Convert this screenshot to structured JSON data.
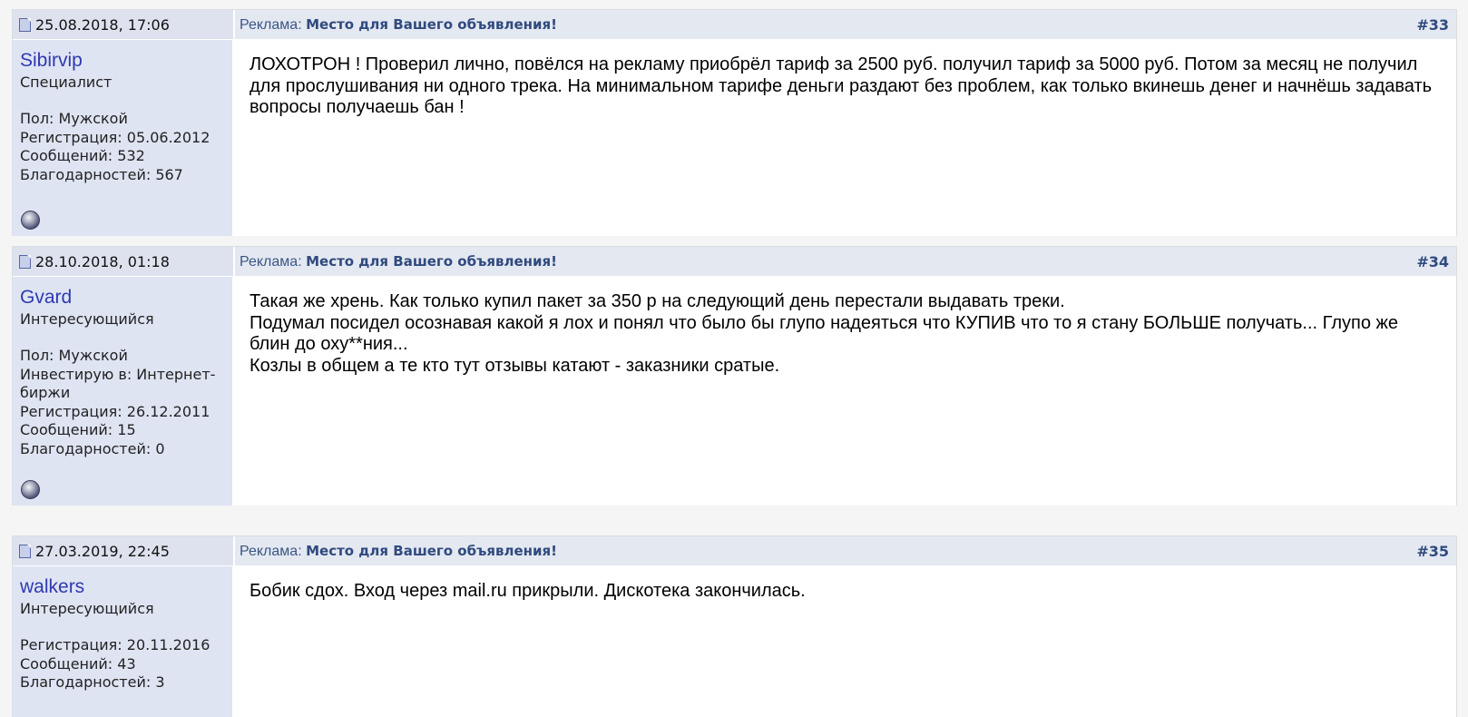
{
  "posts": [
    {
      "date": "25.08.2018, 17:06",
      "ad_label": "Реклама",
      "ad_sep": ":",
      "ad_link": "Место для Вашего объявления!",
      "number": "#33",
      "username": "Sibirvip",
      "user_title": "Специалист",
      "info": [
        "Пол: Мужской",
        "Регистрация: 05.06.2012",
        "Сообщений: 532",
        "Благодарностей: 567"
      ],
      "message": [
        "ЛОХОТРОН ! Проверил лично, повёлся на рекламу приобрёл тариф за 2500 руб. получил тариф за 5000 руб. Потом за месяц не получил для прослушивания ни одного трека. На минимальном тарифе деньги раздают без проблем, как только вкинешь денег и начнёшь задавать вопросы получаешь бан !"
      ]
    },
    {
      "date": "28.10.2018, 01:18",
      "ad_label": "Реклама",
      "ad_sep": ":",
      "ad_link": "Место для Вашего объявления!",
      "number": "#34",
      "username": "Gvard",
      "user_title": "Интересующийся",
      "info": [
        "Пол: Мужской",
        "Инвестирую в: Интернет-биржи",
        "Регистрация: 26.12.2011",
        "Сообщений: 15",
        "Благодарностей: 0"
      ],
      "message": [
        "Такая же хрень. Как только купил пакет за 350 р на следующий день перестали выдавать треки.",
        "Подумал посидел осознавая какой я лох и понял что было бы глупо надеяться что КУПИВ что то я стану БОЛЬШЕ получать... Глупо же блин до оху**ния...",
        "Козлы в общем а те кто тут отзывы катают - заказники сратые."
      ]
    },
    {
      "date": "27.03.2019, 22:45",
      "ad_label": "Реклама",
      "ad_sep": ":",
      "ad_link": "Место для Вашего объявления!",
      "number": "#35",
      "username": "walkers",
      "user_title": "Интересующийся",
      "info": [
        "Регистрация: 20.11.2016",
        "Сообщений: 43",
        "Благодарностей: 3"
      ],
      "message": [
        "Бобик сдох. Вход через mail.ru прикрыли. Дискотека закончилась."
      ]
    }
  ]
}
